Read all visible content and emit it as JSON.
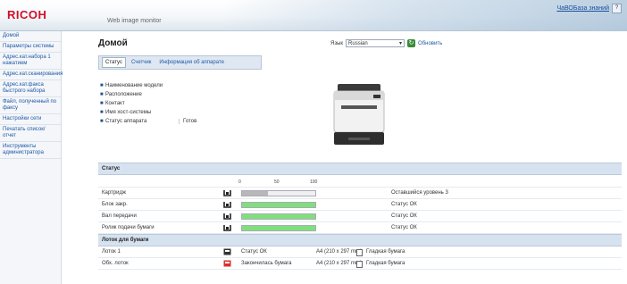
{
  "header": {
    "logo": "RICOH",
    "product_title": "Web image monitor",
    "user_link": "ЧаВОБаза знаний",
    "help_icon": "help-icon"
  },
  "sidebar": {
    "items": [
      {
        "label": "Домой"
      },
      {
        "label": "Параметры системы"
      },
      {
        "label": "Адрес.кат.набора 1 нажатием"
      },
      {
        "label": "Адрес.кат.сканирования"
      },
      {
        "label": "Адрес.кат.факса быстрого набора"
      },
      {
        "label": "Файл, полученный по факсу"
      },
      {
        "label": "Настройки сети"
      },
      {
        "label": "Печатать список/отчет"
      },
      {
        "label": "Инструменты администратора"
      }
    ]
  },
  "main": {
    "title": "Домой",
    "language_label": "Язык",
    "language_value": "Russian",
    "refresh_label": "Обновить",
    "tabs": [
      {
        "label": "Статус",
        "active": true
      },
      {
        "label": "Счетчик",
        "active": false
      },
      {
        "label": "Информация об аппарате",
        "active": false
      }
    ],
    "device_info": [
      {
        "label": "Наименование модели",
        "value": ""
      },
      {
        "label": "Расположение",
        "value": ""
      },
      {
        "label": "Контакт",
        "value": ""
      },
      {
        "label": "Имя хост-системы",
        "value": ""
      },
      {
        "label": "Статус аппарата",
        "value": "Готов"
      }
    ]
  },
  "status_section": {
    "title": "Статус",
    "scale": [
      "0",
      "50",
      "100"
    ],
    "rows": [
      {
        "name": "Картридж",
        "level": 0.35,
        "status": "Оставшийся уровень 3",
        "color": "#b8b8b8"
      },
      {
        "name": "Блок закр.",
        "level": 1.0,
        "status": "Статус ОК",
        "color": "#7fe07a"
      },
      {
        "name": "Вал передачи",
        "level": 1.0,
        "status": "Статус ОК",
        "color": "#7fe07a"
      },
      {
        "name": "Ролик подачи бумаги",
        "level": 1.0,
        "status": "Статус ОК",
        "color": "#7fe07a"
      }
    ]
  },
  "tray_section": {
    "title": "Лоток для бумаги",
    "rows": [
      {
        "name": "Лоток 1",
        "status": "Статус ОК",
        "size": "A4 (210 x 297 mm)",
        "type": "Гладкая бумага",
        "icon_color": "#333333"
      },
      {
        "name": "Обх. лоток",
        "status": "Закончилась бумага",
        "size": "A4 (210 x 297 mm)",
        "type": "Гладкая бумага",
        "icon_color": "#d9302a"
      }
    ]
  }
}
